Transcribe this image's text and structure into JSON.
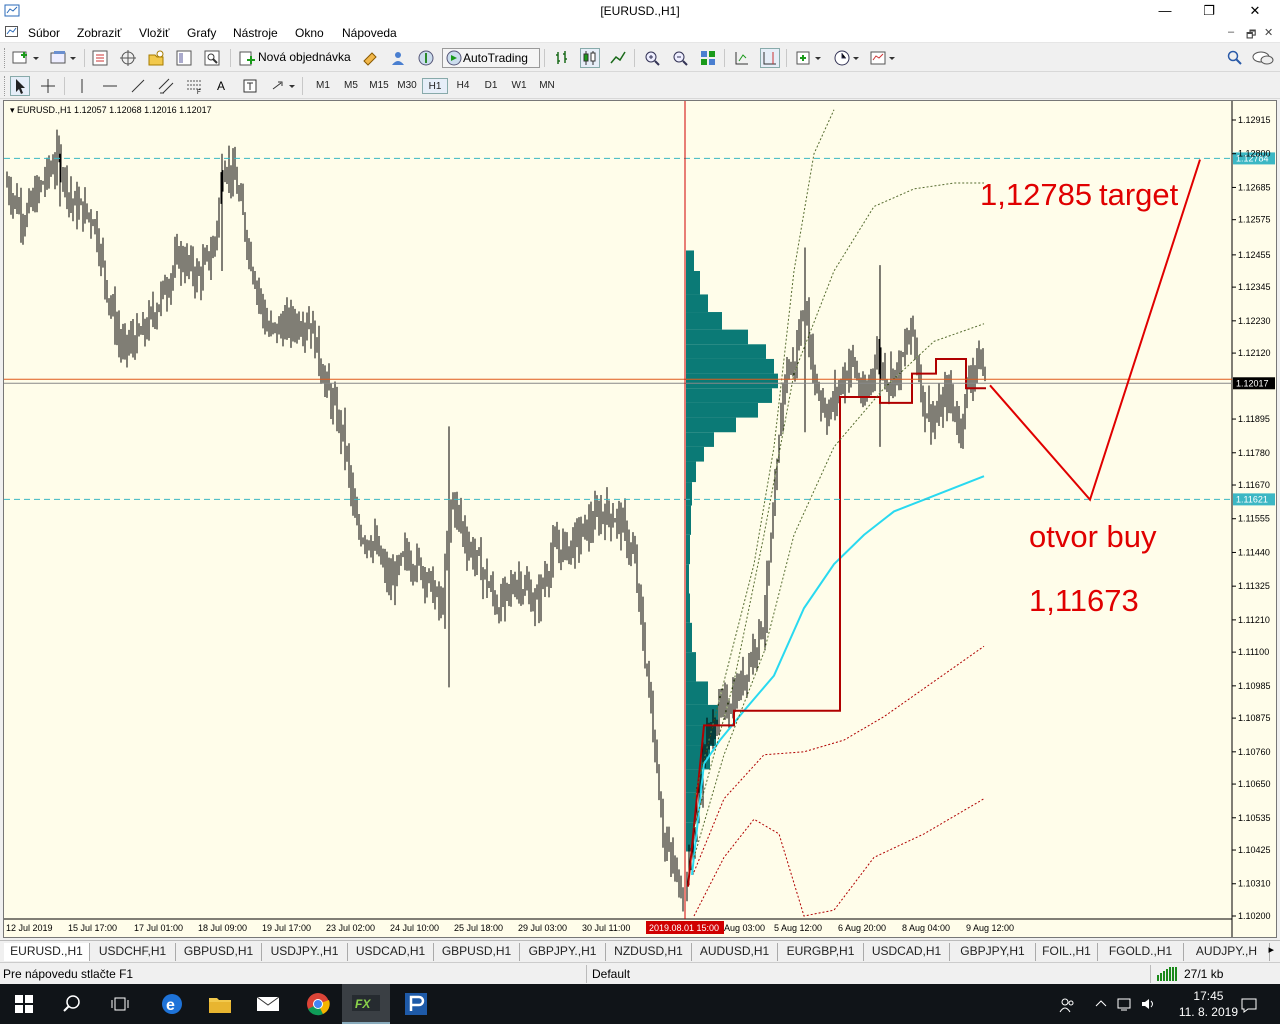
{
  "window": {
    "title": "[EURUSD.,H1]",
    "controls": {
      "minimize": "—",
      "maximize": "❐",
      "close": "✕"
    }
  },
  "menu": {
    "items": [
      "Súbor",
      "Zobraziť",
      "Vložiť",
      "Grafy",
      "Nástroje",
      "Okno",
      "Nápoveda"
    ],
    "mdi_controls": [
      "–",
      "🗗",
      "✕"
    ]
  },
  "toolbar1": {
    "new_order_label": "Nová objednávka",
    "autotrading_label": "AutoTrading"
  },
  "toolbar2": {
    "timeframes": [
      "M1",
      "M5",
      "M15",
      "M30",
      "H1",
      "H4",
      "D1",
      "W1",
      "MN"
    ],
    "active_timeframe": "H1",
    "text_tool": "A"
  },
  "chart": {
    "header": "EURUSD.,H1  1.12057 1.12068 1.12016 1.12017",
    "price_labels": [
      "1.12915",
      "1.12800",
      "1.12685",
      "1.12575",
      "1.12455",
      "1.12345",
      "1.12230",
      "1.12120",
      "1.12017",
      "1.11895",
      "1.11780",
      "1.11670",
      "1.11555",
      "1.11440",
      "1.11325",
      "1.11210",
      "1.11100",
      "1.10985",
      "1.10875",
      "1.10760",
      "1.10650",
      "1.10535",
      "1.10425",
      "1.10310",
      "1.10200"
    ],
    "price_levels": [
      1.12915,
      1.128,
      1.12685,
      1.12575,
      1.12455,
      1.12345,
      1.1223,
      1.1212,
      1.12017,
      1.11895,
      1.1178,
      1.1167,
      1.11555,
      1.1144,
      1.11325,
      1.1121,
      1.111,
      1.10985,
      1.10875,
      1.1076,
      1.1065,
      1.10535,
      1.10425,
      1.1031,
      1.102
    ],
    "hline_upper_label": "1.12784",
    "hline_upper": 1.12784,
    "hline_lower_label": "1.11621",
    "hline_lower": 1.11621,
    "current_price_label": "1.12017",
    "current_price": 1.12017,
    "time_labels": [
      "12 Jul 2019",
      "15 Jul 17:00",
      "17 Jul 01:00",
      "18 Jul 09:00",
      "19 Jul 17:00",
      "23 Jul 02:00",
      "24 Jul 10:00",
      "25 Jul 18:00",
      "29 Jul 03:00",
      "30 Jul 11:00",
      "2019.08.01 15:00",
      "Aug 03:00",
      "5 Aug 12:00",
      "6 Aug 20:00",
      "8 Aug 04:00",
      "9 Aug 12:00"
    ],
    "vline_label": "2019.08.01 15:00",
    "annotations": {
      "target_value": "1,12785",
      "target_word": "target",
      "buy_text": "otvor buy",
      "buy_value": "1,11673"
    },
    "colors": {
      "background": "#fffdea",
      "candles": "#000000",
      "hline": "#3cb7c4",
      "vline": "#d00000",
      "profile": "#0b7a76",
      "vwap": "#29d9f0",
      "annotation": "#e00000"
    }
  },
  "symbol_tabs": [
    "EURUSD.,H1",
    "USDCHF,H1",
    "GBPUSD,H1",
    "USDJPY.,H1",
    "USDCAD,H1",
    "GBPUSD,H1",
    "GBPJPY.,H1",
    "NZDUSD,H1",
    "AUDUSD,H1",
    "EURGBP,H1",
    "USDCAD,H1",
    "GBPJPY,H1",
    "FOIL.,H1",
    "FGOLD.,H1",
    "AUDJPY.,H"
  ],
  "statusbar": {
    "help": "Pre nápovedu stlačte F1",
    "profile": "Default",
    "traffic": "27/1 kb"
  },
  "taskbar": {
    "time": "17:45",
    "date": "11. 8. 2019"
  }
}
